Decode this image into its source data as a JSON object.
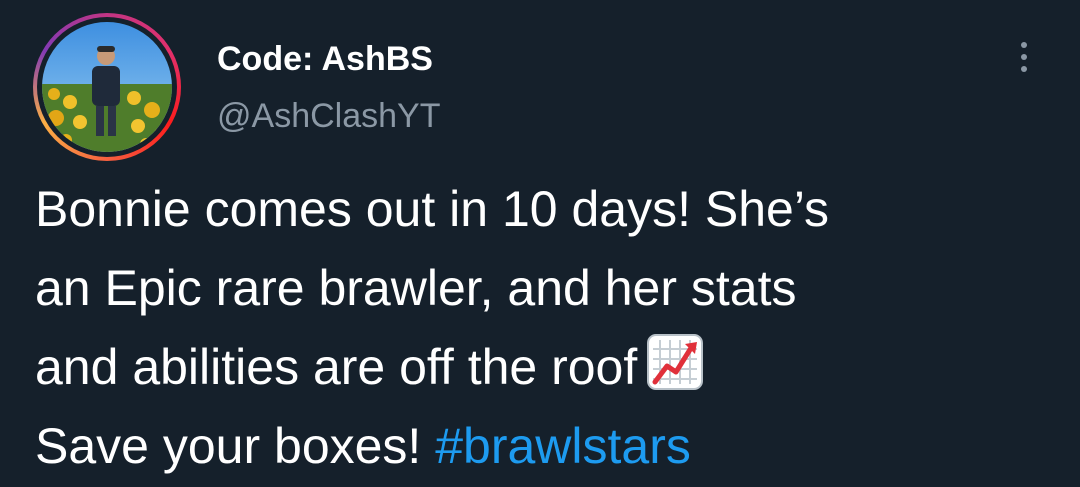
{
  "user": {
    "display_name": "Code: AshBS",
    "handle": "@AshClashYT"
  },
  "tweet": {
    "lines": [
      "Bonnie comes out in 10 days! She’s",
      "an Epic rare brawler, and her stats",
      "and abilities are off the roof"
    ],
    "last_line": "Save your boxes! ",
    "hashtag": "#brawlstars",
    "emoji": "chart-increasing-emoji"
  },
  "colors": {
    "background": "#15202b",
    "text": "#ffffff",
    "secondary": "#8b98a5",
    "link": "#1d9bf0"
  }
}
